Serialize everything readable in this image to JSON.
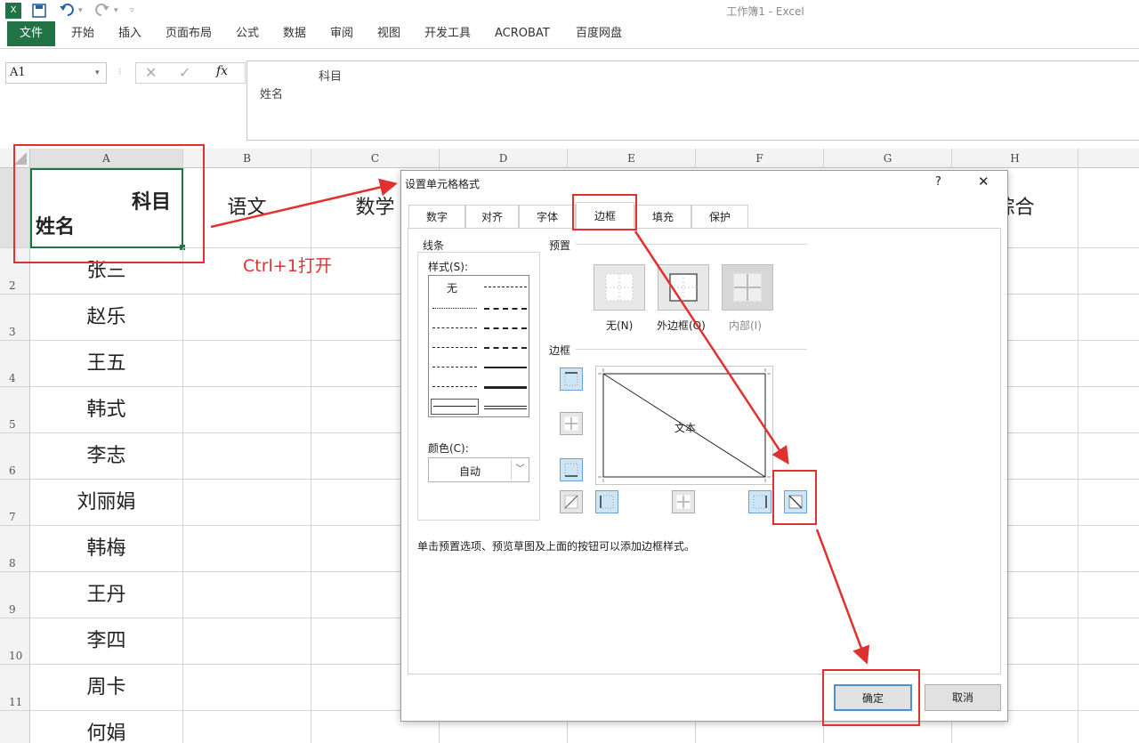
{
  "qat": {
    "excel_icon": "excel-logo-icon",
    "save_icon": "save-icon",
    "undo_icon": "undo-icon",
    "redo_icon": "redo-icon",
    "customize_icon": "customize-icon"
  },
  "window": {
    "title": "工作簿1 - Excel"
  },
  "ribbon": {
    "tabs": [
      "文件",
      "开始",
      "插入",
      "页面布局",
      "公式",
      "数据",
      "审阅",
      "视图",
      "开发工具",
      "ACROBAT",
      "百度网盘"
    ]
  },
  "formula_bar": {
    "name_box": "A1",
    "line1": "科目",
    "line2": "姓名",
    "fx_label": "fx"
  },
  "sheet": {
    "columns": [
      "A",
      "B",
      "C",
      "D",
      "E",
      "F",
      "G",
      "H"
    ],
    "row_numbers": [
      "2",
      "3",
      "4",
      "5",
      "6",
      "7",
      "8",
      "9",
      "10",
      "11"
    ],
    "a1_top": "科目",
    "a1_bottom": "姓名",
    "headers": {
      "b": "语文",
      "c": "数学",
      "h": "综合"
    },
    "names": [
      "张三",
      "赵乐",
      "王五",
      "韩式",
      "李志",
      "刘丽娟",
      "韩梅",
      "王丹",
      "李四",
      "周卡",
      "何娟"
    ]
  },
  "annotation": {
    "shortcut": "Ctrl+1打开"
  },
  "dialog": {
    "title": "设置单元格格式",
    "help": "?",
    "close": "✕",
    "tabs": [
      "数字",
      "对齐",
      "字体",
      "边框",
      "填充",
      "保护"
    ],
    "active_tab": "边框",
    "line_group": "线条",
    "style_label": "样式(S):",
    "style_none": "无",
    "color_label": "颜色(C):",
    "color_value": "自动",
    "presets_group": "预置",
    "preset_none": "无(N)",
    "preset_outline": "外边框(O)",
    "preset_inside": "内部(I)",
    "border_group": "边框",
    "preview_text": "文本",
    "hint": "单击预置选项、预览草图及上面的按钮可以添加边框样式。",
    "ok": "确定",
    "cancel": "取消"
  },
  "colors": {
    "excel_green": "#217346",
    "annotation_red": "#e0312f",
    "active_border_btn": "#cde6f7"
  }
}
